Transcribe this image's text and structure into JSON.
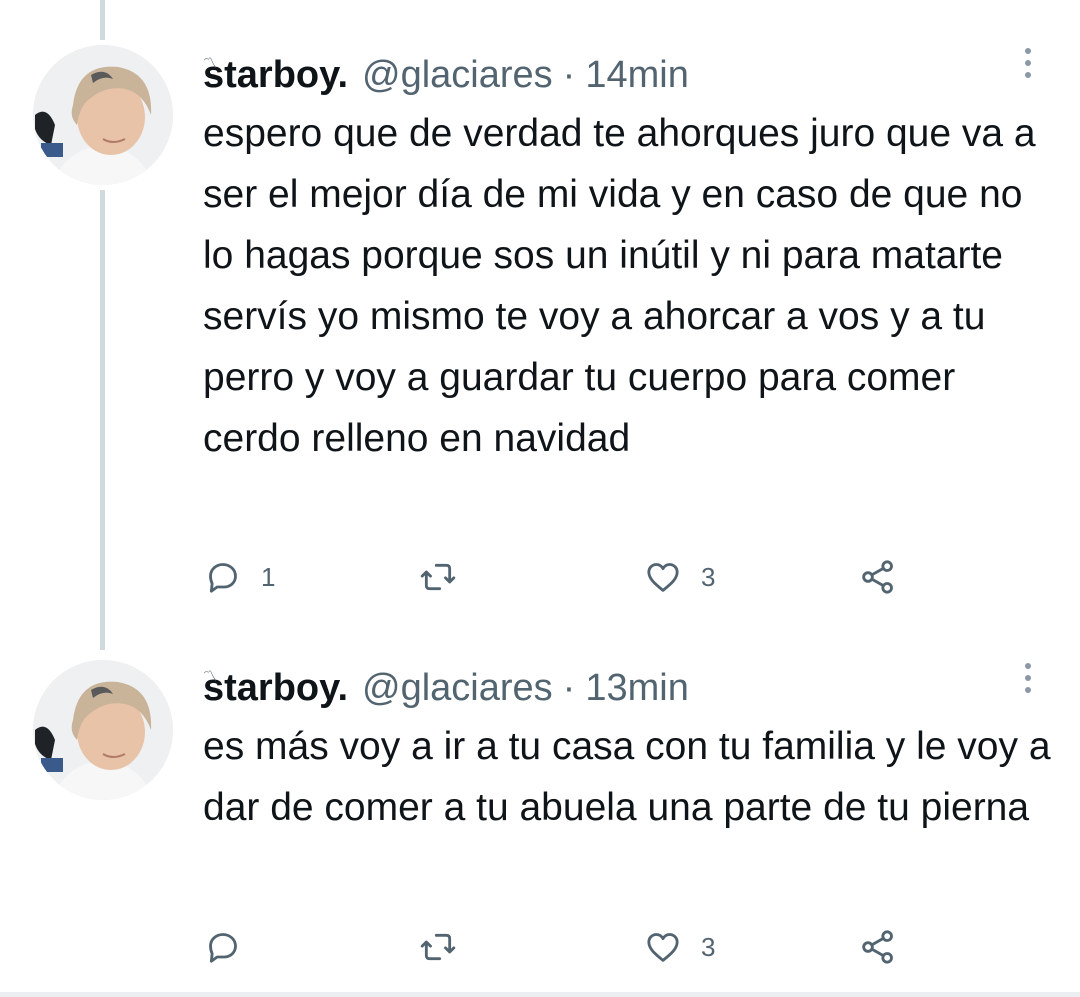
{
  "tweets": [
    {
      "display_name": "starboy.",
      "name_mark": "〽",
      "handle": "@glaciares",
      "separator": "·",
      "time": "14min",
      "text": "espero que de verdad te ahorques juro que va a ser el mejor día de mi vida y en caso de que no lo hagas porque sos un inútil y ni para matarte servís yo mismo te voy a ahorcar a vos y a tu perro y voy a guardar tu cuerpo para comer cerdo relleno en navidad",
      "replies": "1",
      "retweets": "",
      "likes": "3",
      "icons": {
        "reply": "reply-icon",
        "retweet": "retweet-icon",
        "like": "heart-icon",
        "share": "share-icon",
        "more": "more-vertical-icon"
      }
    },
    {
      "display_name": "starboy.",
      "name_mark": "〽",
      "handle": "@glaciares",
      "separator": "·",
      "time": "13min",
      "text": "es más voy a ir a tu casa con tu familia y le voy a dar de comer a tu abuela una parte de tu pierna",
      "replies": "",
      "retweets": "",
      "likes": "3",
      "icons": {
        "reply": "reply-icon",
        "retweet": "retweet-icon",
        "like": "heart-icon",
        "share": "share-icon",
        "more": "more-vertical-icon"
      }
    }
  ],
  "colors": {
    "text": "#0f1419",
    "muted": "#536471",
    "thread_line": "#cfd9de"
  }
}
